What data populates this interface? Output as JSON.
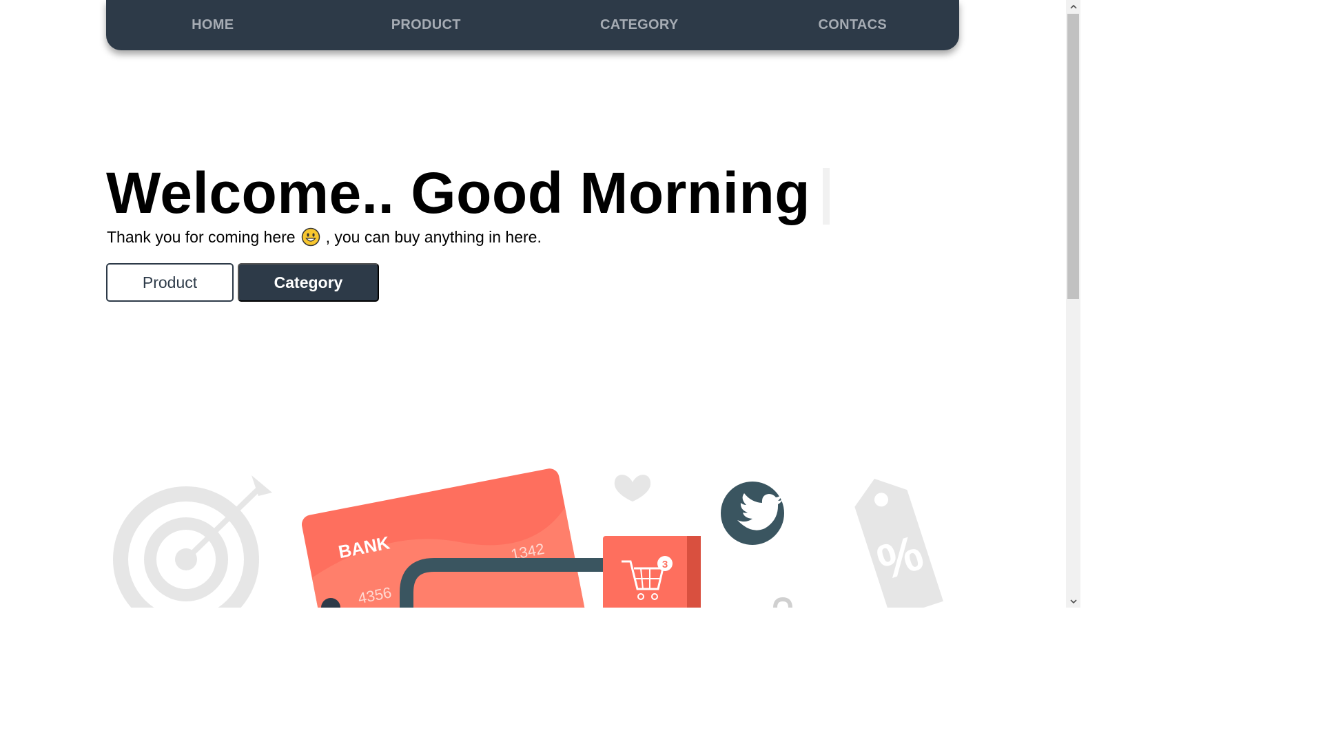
{
  "nav": {
    "items": [
      {
        "label": "HOME"
      },
      {
        "label": "PRODUCT"
      },
      {
        "label": "CATEGORY"
      },
      {
        "label": "CONTACS"
      }
    ]
  },
  "hero": {
    "title": "Welcome.. Good Morning",
    "subtitle_before": "Thank you for coming here",
    "subtitle_after": ", you can buy anything in here.",
    "emoji_icon": "grinning-face-icon"
  },
  "buttons": {
    "product_label": "Product",
    "category_label": "Category"
  },
  "illustration": {
    "bank_label": "BANK",
    "card_number_left": "4356",
    "card_number_right": "1342",
    "cart_badge": "3",
    "percent_symbol": "%"
  },
  "colors": {
    "navbar": "#2d3a48",
    "nav_text": "#a6acb4",
    "card": "#fe6f5e",
    "twitter": "#3a5560"
  }
}
